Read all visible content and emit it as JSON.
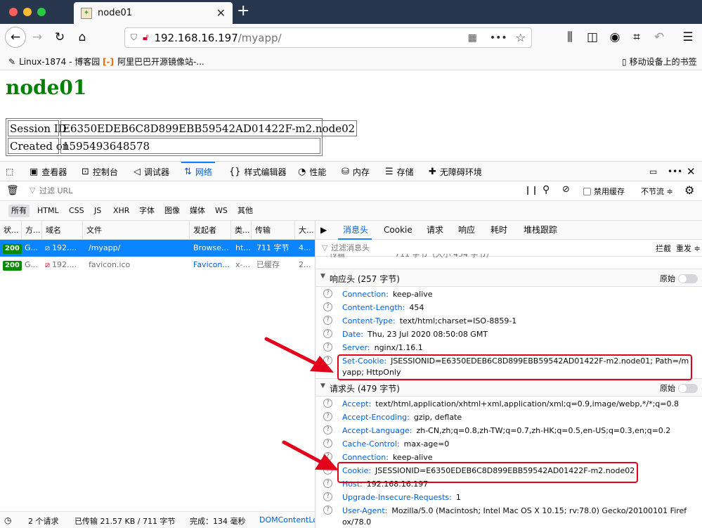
{
  "browser": {
    "tab_title": "node01",
    "url_host": "192.168.16.197",
    "url_path": "/myapp/",
    "bookmarks": [
      "Linux-1874 - 博客园",
      "阿里巴巴开源镜像站-..."
    ],
    "mobile_bookmarks": "移动设备上的书签"
  },
  "page": {
    "heading": "node01",
    "rows": [
      {
        "label": "Session ID",
        "value": "E6350EDEB6C8D899EBB59542AD01422F-m2.node02"
      },
      {
        "label": "Created on",
        "value": "1595493648578"
      }
    ]
  },
  "devtools": {
    "tabs": [
      "查看器",
      "控制台",
      "调试器",
      "网络",
      "样式编辑器",
      "性能",
      "内存",
      "存储",
      "无障碍环境"
    ],
    "filter_placeholder": "过滤 URL",
    "disable_cache": "禁用缓存",
    "throttle": "不节流 ≑",
    "types": [
      "所有",
      "HTML",
      "CSS",
      "JS",
      "XHR",
      "字体",
      "图像",
      "媒体",
      "WS",
      "其他"
    ],
    "columns": [
      "状...",
      "方...",
      "域名",
      "文件",
      "发起者",
      "类...",
      "传输",
      "大..."
    ],
    "requests": [
      {
        "status": "200",
        "method": "G...",
        "domain": "192....",
        "file": "/myapp/",
        "initiator": "Browse...",
        "type": "ht...",
        "transferred": "711 字节",
        "size": "4..."
      },
      {
        "status": "200",
        "method": "G...",
        "domain": "192....",
        "file": "favicon.ico",
        "initiator": "Favicon...",
        "type": "x-...",
        "transferred": "已缓存",
        "size": "2..."
      }
    ],
    "statusbar": {
      "requests": "2 个请求",
      "transferred": "已传输 21.57 KB / 711 字节",
      "finish": "完成：134 毫秒",
      "dcl": "DOMContentLo"
    },
    "side_tabs": [
      "消息头",
      "Cookie",
      "请求",
      "响应",
      "耗时",
      "堆栈跟踪"
    ],
    "side_filter_placeholder": "过滤消息头",
    "block": "拦截",
    "resend": "重发 ≑",
    "partial_line": "711 字节（大小 454 字节）",
    "partial_key": "传输",
    "response_section": "响应头 (257 字节)",
    "request_section": "请求头 (479 字节)",
    "raw": "原始",
    "response_headers": [
      {
        "k": "Connection:",
        "v": "keep-alive"
      },
      {
        "k": "Content-Length:",
        "v": "454"
      },
      {
        "k": "Content-Type:",
        "v": "text/html;charset=ISO-8859-1"
      },
      {
        "k": "Date:",
        "v": "Thu, 23 Jul 2020 08:50:08 GMT"
      },
      {
        "k": "Server:",
        "v": "nginx/1.16.1"
      },
      {
        "k": "Set-Cookie:",
        "v": "JSESSIONID=E6350EDEB6C8D899EBB59542AD01422F-m2.node01; Path=/myapp; HttpOnly"
      }
    ],
    "request_headers": [
      {
        "k": "Accept:",
        "v": "text/html,application/xhtml+xml,application/xml;q=0.9,image/webp,*/*;q=0.8"
      },
      {
        "k": "Accept-Encoding:",
        "v": "gzip, deflate"
      },
      {
        "k": "Accept-Language:",
        "v": "zh-CN,zh;q=0.8,zh-TW;q=0.7,zh-HK;q=0.5,en-US;q=0.3,en;q=0.2"
      },
      {
        "k": "Cache-Control:",
        "v": "max-age=0"
      },
      {
        "k": "Connection:",
        "v": "keep-alive"
      },
      {
        "k": "Cookie:",
        "v": "JSESSIONID=E6350EDEB6C8D899EBB59542AD01422F-m2.node02"
      },
      {
        "k": "Host:",
        "v": "192.168.16.197"
      },
      {
        "k": "Upgrade-Insecure-Requests:",
        "v": "1"
      },
      {
        "k": "User-Agent:",
        "v": "Mozilla/5.0 (Macintosh; Intel Mac OS X 10.15; rv:78.0) Gecko/20100101 Firefox/78.0"
      }
    ],
    "colors": {
      "accent": "#0a84ff",
      "highlight": "#e3001b",
      "status_ok": "#058b00"
    }
  }
}
